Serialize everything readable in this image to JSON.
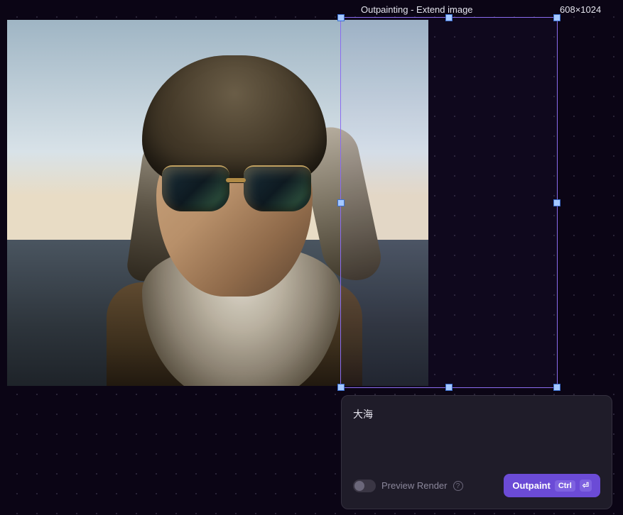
{
  "selection": {
    "title": "Outpainting - Extend image",
    "dimensions": "608×1024"
  },
  "prompt": {
    "value": "大海"
  },
  "controls": {
    "preview_label": "Preview Render",
    "outpaint_label": "Outpaint",
    "shortcut_key": "Ctrl",
    "enter_glyph": "⏎"
  }
}
